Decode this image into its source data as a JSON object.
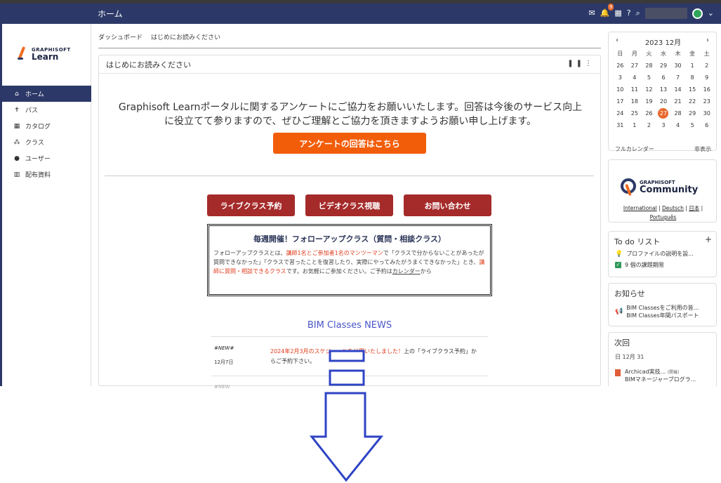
{
  "topbar": {
    "title": "ホーム",
    "notification_count": "9"
  },
  "logo": {
    "brand": "GRAPHISOFT",
    "product": "Learn"
  },
  "sidebar": {
    "items": [
      {
        "label": "ホーム",
        "icon": "home-icon"
      },
      {
        "label": "パス",
        "icon": "path-icon"
      },
      {
        "label": "カタログ",
        "icon": "catalog-icon"
      },
      {
        "label": "クラス",
        "icon": "class-icon"
      },
      {
        "label": "ユーザー",
        "icon": "user-icon"
      },
      {
        "label": "配布資料",
        "icon": "materials-icon"
      }
    ]
  },
  "tabs": [
    "ダッシュボード",
    "はじめにお読みください"
  ],
  "card": {
    "title": "はじめにお読みください",
    "intro_line1": "Graphisoft Learnポータルに関するアンケートにご協力をお願いいたします。回答は今後のサービス向上",
    "intro_line2": "に役立てて参りますので、ぜひご理解とご協力を頂きますようお願い申し上げます。",
    "survey_button": "アンケートの回答はこちら",
    "buttons": [
      "ライブクラス予約",
      "ビデオクラス視聴",
      "お問い合わせ"
    ],
    "follow": {
      "title": "毎週開催！フォローアップクラス（質問・相談クラス）",
      "p1": "フォローアップクラスとは、",
      "p1_red": "講師1名とご参加者1名のマンツーマン",
      "p2": "で「クラスで分からないことがあったが質問できなかった」「クラスで習ったことを復習したり、実際にやってみたがうまくできなかった」とき、",
      "p2_red": "講師に質問・相談できるクラス",
      "p3": "です。お気軽にご参加ください。ご予約は",
      "link": "カレンダー",
      "p4": "から"
    },
    "news": {
      "title": "BIM Classes NEWS",
      "tag": "#NEW#",
      "date": "12月7日",
      "text_red": "2024年2月3月のスケジュールを公開いたしました！",
      "text": "上の「ライブクラス予約」からご予約下さい。",
      "tag2": "#NEW"
    }
  },
  "calendar": {
    "month": "2023 12月",
    "dows": [
      "日",
      "月",
      "火",
      "水",
      "木",
      "金",
      "土"
    ],
    "days": [
      "26",
      "27",
      "28",
      "29",
      "30",
      "1",
      "2",
      "3",
      "4",
      "5",
      "6",
      "7",
      "8",
      "9",
      "10",
      "11",
      "12",
      "13",
      "14",
      "15",
      "16",
      "17",
      "18",
      "19",
      "20",
      "21",
      "22",
      "23",
      "24",
      "25",
      "26",
      "27",
      "28",
      "29",
      "30",
      "31",
      "1",
      "2",
      "3",
      "4",
      "5",
      "6"
    ],
    "today_index": 31,
    "full_calendar": "フルカレンダー",
    "hide": "非表示"
  },
  "community": {
    "brand": "GRAPHISOFT",
    "name": "Community",
    "links": [
      "International",
      "Deutsch",
      "日本",
      "Português"
    ]
  },
  "todo": {
    "title": "To do リスト",
    "items": [
      "プロファイルの説明を設...",
      "9 個の課題期限"
    ]
  },
  "notice": {
    "title": "お知らせ",
    "items": [
      "BIM Classesをご利用の皆...",
      "BIM Classes年間パスポート"
    ]
  },
  "next": {
    "title": "次回",
    "date": "日 12月 31",
    "item1": "Archicad実技...",
    "item1_tag": "(開催)",
    "item2": "BIMマネージャープログラ..."
  },
  "colors": {
    "nav": "#2c3968",
    "accent": "#f25d0a",
    "button_red": "#a52a2a",
    "news_blue": "#4a56c8"
  }
}
